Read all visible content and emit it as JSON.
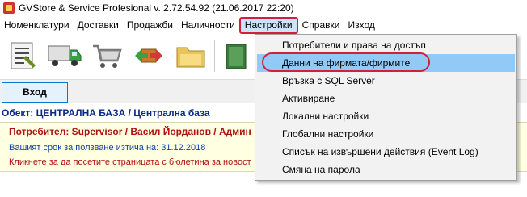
{
  "window": {
    "title": "GVStore & Service Profesional v. 2.72.54.92 (21.06.2017 22:20)",
    "icon": "app-logo-icon"
  },
  "menubar": {
    "items": [
      {
        "label": "Номенклатури"
      },
      {
        "label": "Доставки"
      },
      {
        "label": "Продажби"
      },
      {
        "label": "Наличности"
      },
      {
        "label": "Настройки",
        "active": true
      },
      {
        "label": "Справки"
      },
      {
        "label": "Изход"
      }
    ]
  },
  "toolbar": {
    "icons": [
      "document-list-icon",
      "delivery-truck-icon",
      "shopping-cart-icon",
      "return-arrows-icon",
      "folder-icon",
      "book-icon"
    ]
  },
  "login": {
    "button_label": "Вход"
  },
  "object": {
    "text": "Обект: ЦЕНТРАЛНА БАЗА / Централна база"
  },
  "info": {
    "user": "Потребител: Supervisor / Васил Йорданов / Админ",
    "expiry": "Вашият срок за ползване изтича на: 31.12.2018",
    "news_link": "Кликнете за да посетите страницата с бюлетина за новост"
  },
  "dropdown": {
    "items": [
      {
        "label": "Потребители и права на достъп"
      },
      {
        "label": "Данни на фирмата/фирмите",
        "highlighted": true
      },
      {
        "label": "Връзка с SQL Server"
      },
      {
        "label": "Активиране"
      },
      {
        "label": "Локални настройки"
      },
      {
        "label": "Глобални настройки"
      },
      {
        "label": "Списък на извършени действия (Event Log)"
      },
      {
        "label": "Смяна на парола"
      }
    ]
  },
  "colors": {
    "menu_highlight": "#cce4f7",
    "annotation_red": "#d21f3c",
    "dropdown_highlight": "#91c9f7",
    "object_text": "#0a2a8a",
    "user_text": "#b01010",
    "expiry_text": "#1040a8",
    "info_background": "#ffffe1"
  }
}
